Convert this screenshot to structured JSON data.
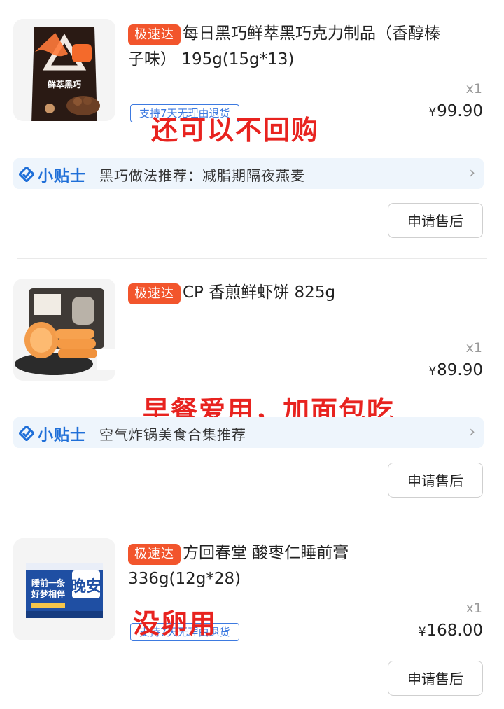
{
  "orders": [
    {
      "badge": "极速达",
      "title_line1": "每日黑巧鲜萃黑巧克力制品（香醇榛",
      "title_line2": "子味） 195g(15g*13)",
      "qty": "x1",
      "currency": "¥",
      "price": "99.90",
      "return_policy": "支持7天无理由退货",
      "annotation": "还可以不回购",
      "tip_brand": "小贴士",
      "tip_text": "黑巧做法推荐：减脂期隔夜燕麦",
      "after_sale": "申请售后",
      "thumb_label": "鲜萃黑巧",
      "thumb_icon": "chocolate-package-image"
    },
    {
      "badge": "极速达",
      "title_line1": "CP 香煎鲜虾饼 825g",
      "title_line2": "",
      "qty": "x1",
      "currency": "¥",
      "price": "89.90",
      "annotation": "早餐爱用，加面包吃",
      "tip_brand": "小贴士",
      "tip_text": "空气炸锅美食合集推荐",
      "after_sale": "申请售后",
      "thumb_icon": "shrimp-cake-image"
    },
    {
      "badge": "极速达",
      "title_line1": "方回春堂 酸枣仁睡前膏",
      "title_line2": "336g(12g*28)",
      "qty": "x1",
      "currency": "¥",
      "price": "168.00",
      "return_policy": "支持7天无理由退货",
      "annotation": "没卵用",
      "after_sale": "申请售后",
      "thumb_label1": "睡前一条",
      "thumb_label2": "好梦相伴",
      "thumb_label3": "晚安",
      "thumb_icon": "sleep-paste-box-image"
    }
  ],
  "colors": {
    "badge": "#f2552c",
    "annotation": "#e8231f",
    "tip_brand": "#1f6fd8",
    "tip_bg": "#eef5fc"
  }
}
